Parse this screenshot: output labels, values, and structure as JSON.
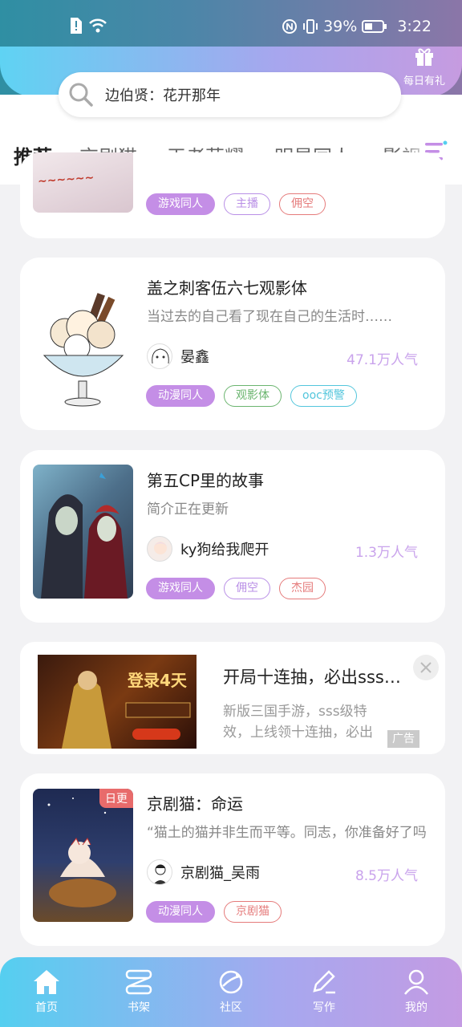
{
  "status_bar": {
    "battery": "39%",
    "time": "3:22"
  },
  "gift": {
    "label": "每日有礼"
  },
  "search": {
    "text": "边伯贤：花开那年"
  },
  "tabs": [
    {
      "label": "推荐",
      "active": true
    },
    {
      "label": "京剧猫"
    },
    {
      "label": "王者荣耀"
    },
    {
      "label": "明星同人"
    },
    {
      "label": "影视"
    }
  ],
  "partial_card": {
    "tags": [
      "游戏同人",
      "主播",
      "佣空"
    ]
  },
  "books": [
    {
      "title": "盖之刺客伍六七观影体",
      "desc": "当过去的自己看了现在自己的生活时‥‥‥",
      "author": "晏鑫",
      "popularity": "47.1万人气",
      "tags": [
        "动漫同人",
        "观影体",
        "ooc预警"
      ]
    },
    {
      "title": "第五CP里的故事",
      "desc": "简介正在更新",
      "author": "ky狗给我爬开",
      "popularity": "1.3万人气",
      "tags": [
        "游戏同人",
        "佣空",
        "杰园"
      ]
    },
    {
      "title": "京剧猫：命运",
      "desc": "“猫土的猫并非生而平等。同志，你准备好了吗",
      "author": "京剧猫_吴雨",
      "popularity": "8.5万人气",
      "tags": [
        "动漫同人",
        "京剧猫"
      ],
      "badge": "日更"
    }
  ],
  "ad": {
    "title": "开局十连抽，必出sss…",
    "desc": "新版三国手游，sss级特效，上线领十连抽，必出",
    "label": "广告",
    "image_text": "登录4天"
  },
  "bottom_nav": [
    {
      "label": "首页",
      "icon": "home-icon"
    },
    {
      "label": "书架",
      "icon": "bookshelf-icon"
    },
    {
      "label": "社区",
      "icon": "planet-icon"
    },
    {
      "label": "写作",
      "icon": "pen-icon"
    },
    {
      "label": "我的",
      "icon": "profile-icon"
    }
  ],
  "colors": {
    "accent": "#c48ee6",
    "popularity": "#c9a3ec",
    "badge": "#e86b6b"
  }
}
